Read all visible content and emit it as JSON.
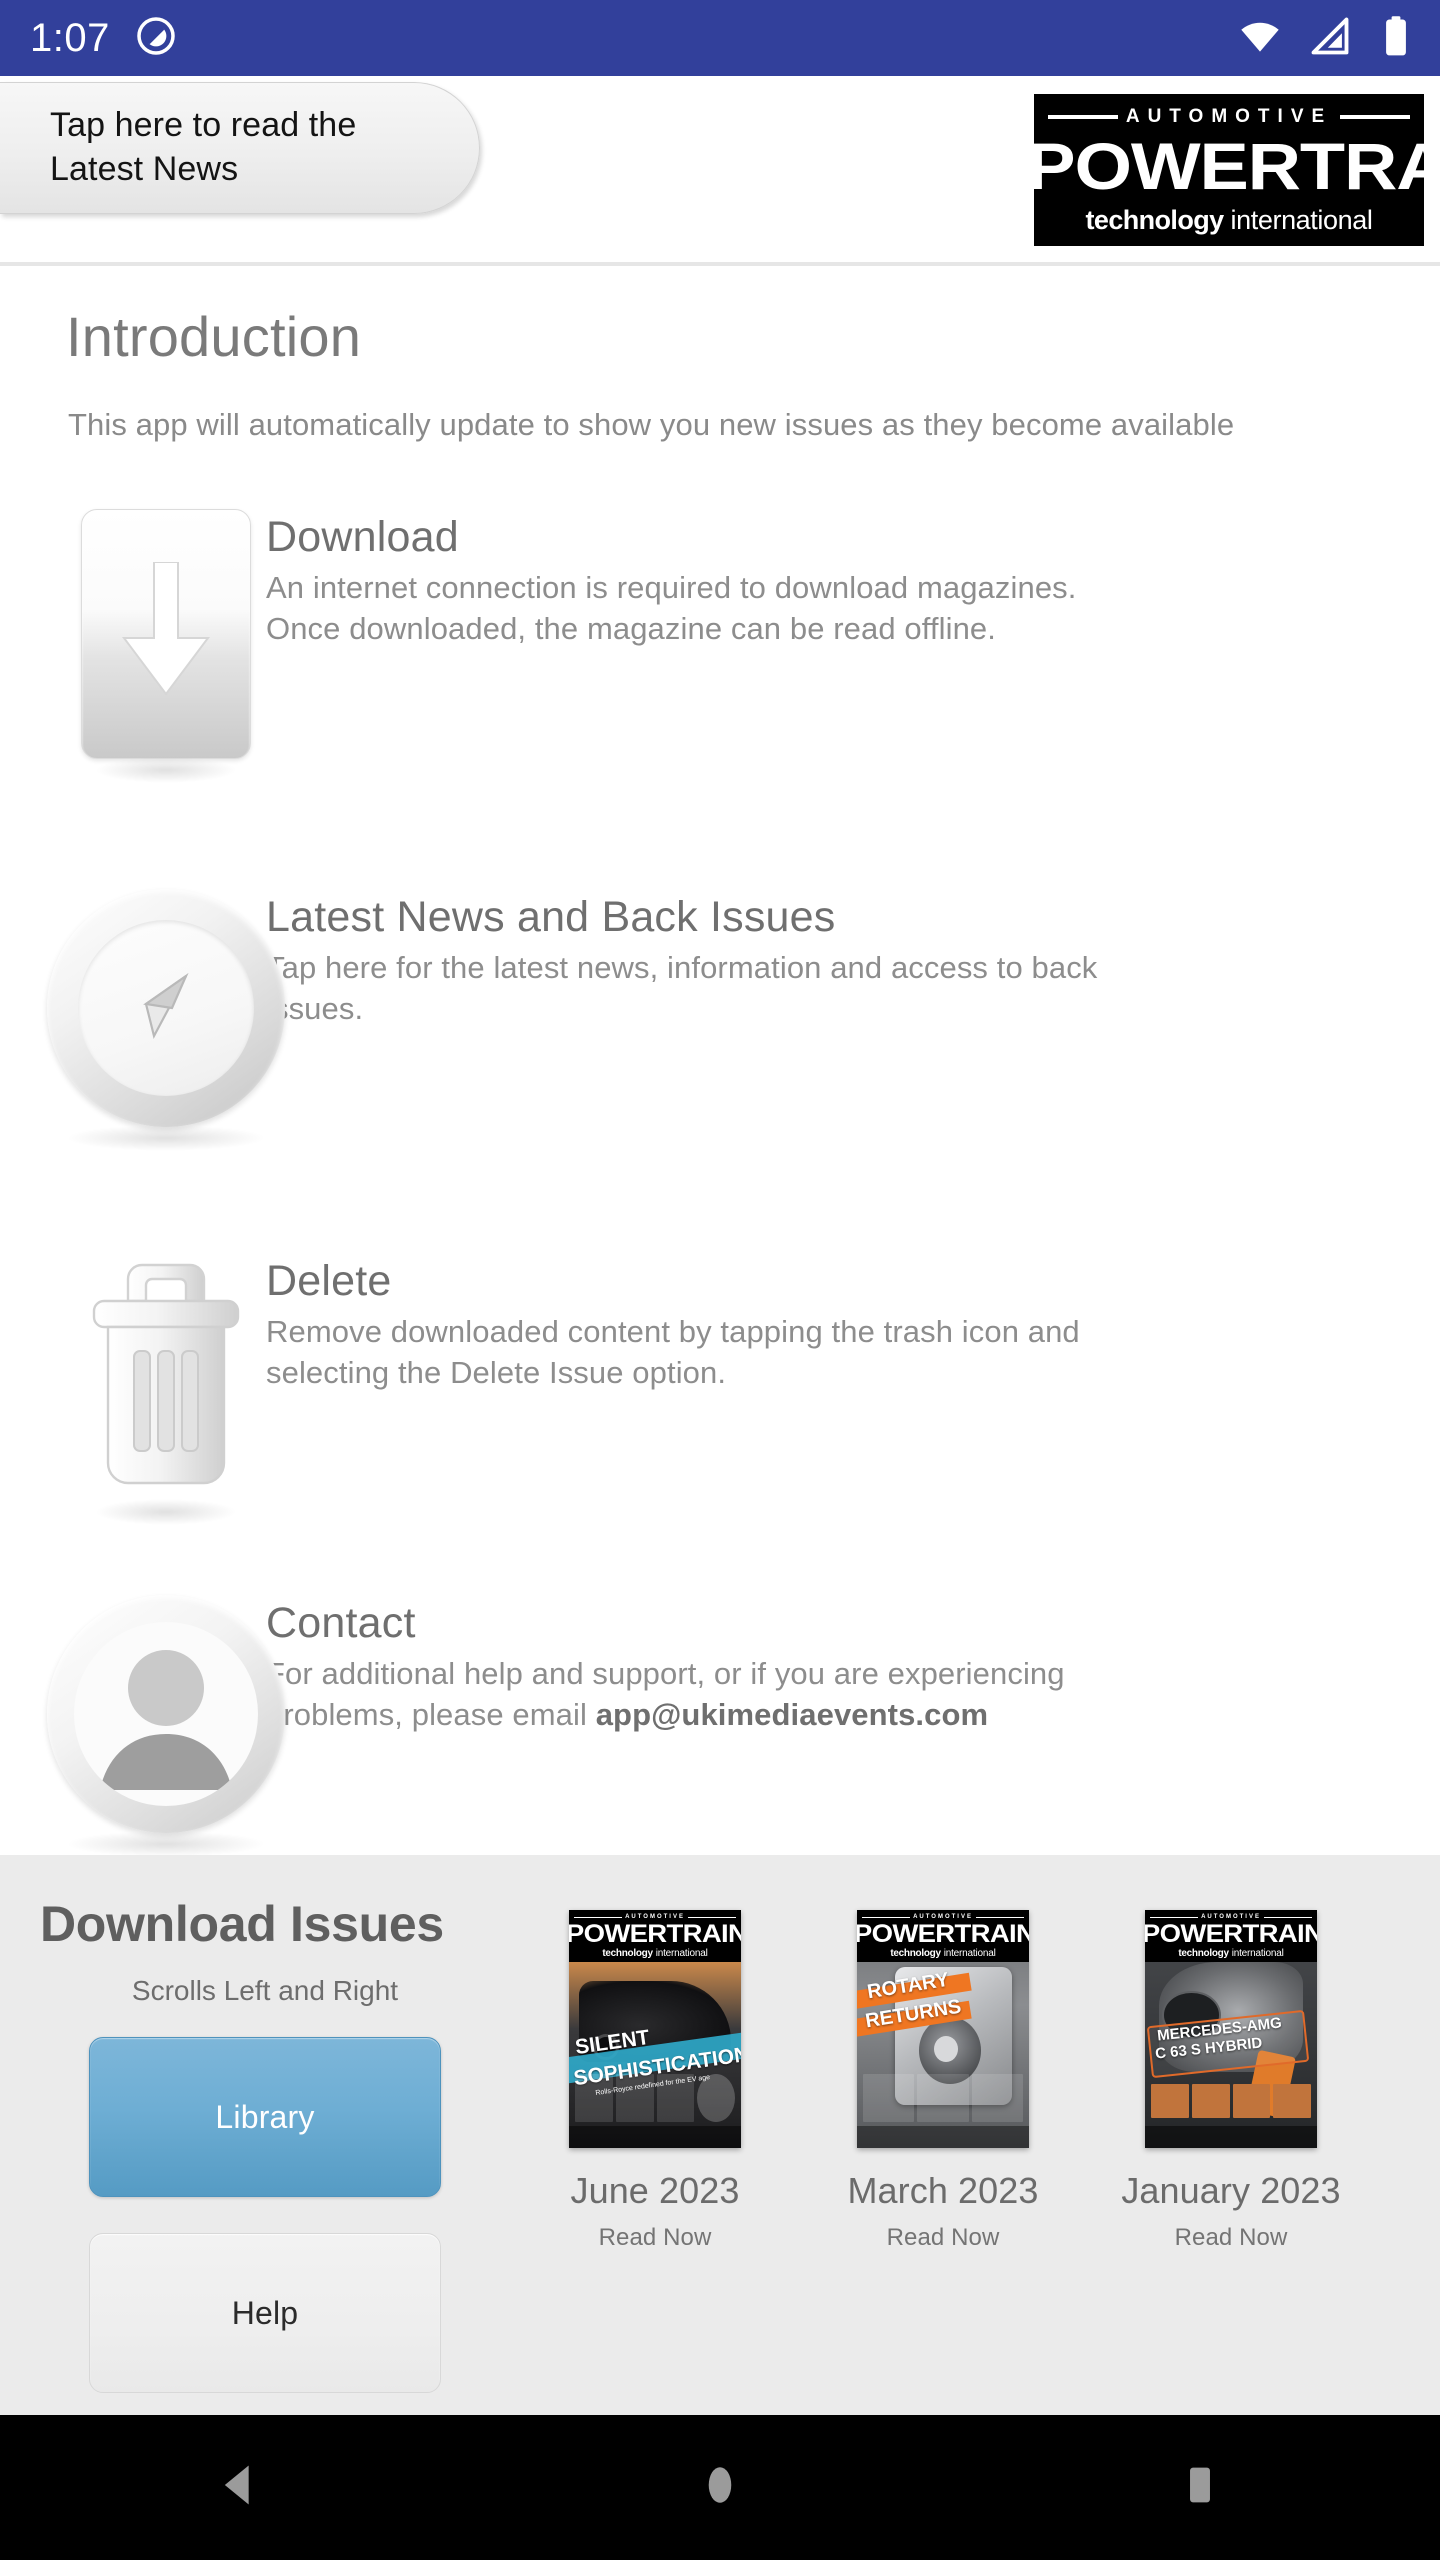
{
  "status_bar": {
    "time": "1:07",
    "notification_icon": "do-not-disturb-icon",
    "wifi_icon": "wifi-icon",
    "signal_icon": "cellular-signal-icon",
    "battery_icon": "battery-full-icon",
    "background_color": "#32409b"
  },
  "header": {
    "news_tab_line1": "Tap here to read the",
    "news_tab_line2": "Latest News",
    "logo": {
      "automotive": "AUTOMOTIVE",
      "powertrain": "POWERTRAIN",
      "technology": "technology",
      "international": "international"
    }
  },
  "main": {
    "title": "Introduction",
    "subtitle": "This app will automatically update to show you new issues as they become available",
    "features": [
      {
        "icon": "download-arrow-icon",
        "title": "Download",
        "desc_line1": "An internet connection is required to download magazines.",
        "desc_line2": "Once downloaded, the magazine can be read offline."
      },
      {
        "icon": "compass-icon",
        "title": "Latest News and Back Issues",
        "desc_line1": "Tap here for the latest news, information and access to back",
        "desc_line2": "issues."
      },
      {
        "icon": "trash-can-icon",
        "title": "Delete",
        "desc_line1": "Remove downloaded content by tapping the trash icon and",
        "desc_line2": "selecting the Delete Issue option."
      },
      {
        "icon": "person-avatar-icon",
        "title": "Contact",
        "desc_line1": "For additional help and support, or if you are experiencing",
        "desc_line2_prefix": "problems, please email ",
        "desc_email": "app@ukimediaevents.com"
      }
    ]
  },
  "bottom_panel": {
    "heading": "Download Issues",
    "subheading": "Scrolls Left and Right",
    "library_button": "Library",
    "help_button": "Help",
    "library_button_color": "#6eaed4",
    "background_color": "#ebebeb",
    "issues": [
      {
        "title": "June 2023",
        "action": "Read Now",
        "cover_headline_line1": "SILENT",
        "cover_headline_line2": "SOPHISTICATION",
        "cover_subline": "Rolls-Royce redefined for the EV age",
        "cover_accent": "#2fa8c8",
        "cover_theme": "sunset-car"
      },
      {
        "title": "March 2023",
        "action": "Read Now",
        "cover_headline_line1": "ROTARY",
        "cover_headline_line2": "RETURNS",
        "cover_subline": "",
        "cover_accent": "#ef7622",
        "cover_theme": "rotary-engine"
      },
      {
        "title": "January 2023",
        "action": "Read Now",
        "cover_headline_line1": "MERCEDES-AMG",
        "cover_headline_line2": "C 63 S HYBRID",
        "cover_subline": "",
        "cover_accent": "#e06a2a",
        "cover_theme": "turbo-engine"
      }
    ]
  },
  "nav_bar": {
    "back": "back-triangle-icon",
    "home": "home-circle-icon",
    "recents": "recents-square-icon"
  }
}
